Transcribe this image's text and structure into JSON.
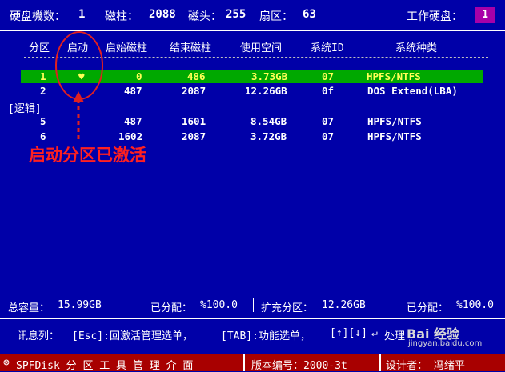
{
  "topbar": {
    "disk_count_label": "硬盘機数：",
    "disk_count": "1",
    "cylinders_label": "磁柱：",
    "cylinders": "2088",
    "heads_label": "磁头：",
    "heads": "255",
    "sectors_label": "扇区：",
    "sectors": "63",
    "working_disk_label": "工作硬盘：",
    "working_disk": "1"
  },
  "table": {
    "headers": {
      "partition": "分区",
      "boot": "启动",
      "start_cyl": "启始磁柱",
      "end_cyl": "结束磁柱",
      "used_space": "使用空间",
      "system_id": "系统ID",
      "system_type": "系统种类"
    },
    "logical_label": "[逻辑]",
    "rows": [
      {
        "partition": "1",
        "boot": "♥",
        "start": "0",
        "end": "486",
        "size": "3.73GB",
        "id": "07",
        "type": "HPFS/NTFS"
      },
      {
        "partition": "2",
        "boot": "",
        "start": "487",
        "end": "2087",
        "size": "12.26GB",
        "id": "0f",
        "type": "DOS Extend(LBA)"
      },
      {
        "partition": "5",
        "boot": "",
        "start": "487",
        "end": "1601",
        "size": "8.54GB",
        "id": "07",
        "type": "HPFS/NTFS"
      },
      {
        "partition": "6",
        "boot": "",
        "start": "1602",
        "end": "2087",
        "size": "3.72GB",
        "id": "07",
        "type": "HPFS/NTFS"
      }
    ]
  },
  "annotation": {
    "text": "启动分区已激活",
    "color": "#FF2020"
  },
  "footer": {
    "total_label": "总容量：",
    "total": "15.99GB",
    "allocated_label": "已分配：",
    "allocated": "%100.0",
    "extended_label": "扩充分区：",
    "extended": "12.26GB",
    "allocated2_label": "已分配：",
    "allocated2": "%100.0"
  },
  "hint": {
    "label": "讯息列：",
    "esc": "[Esc]:回激活管理选单，",
    "tab": "[TAB]:功能选单，",
    "arrows": "[↑][↓]",
    "enter_text": "处理",
    "watermark": "Bai 经验",
    "watermark_url": "jingyan.baidu.com"
  },
  "statusbar": {
    "app": "SPFDisk 分 区 工 具 管 理 介 面",
    "version": "版本编号：2000-3t",
    "designer": "设计者：  冯绪平"
  },
  "colors": {
    "background": "#0000A8",
    "active_row": "#00A800",
    "active_text": "#FFFF55",
    "badge": "#A800A8",
    "statusbar": "#A80000"
  }
}
